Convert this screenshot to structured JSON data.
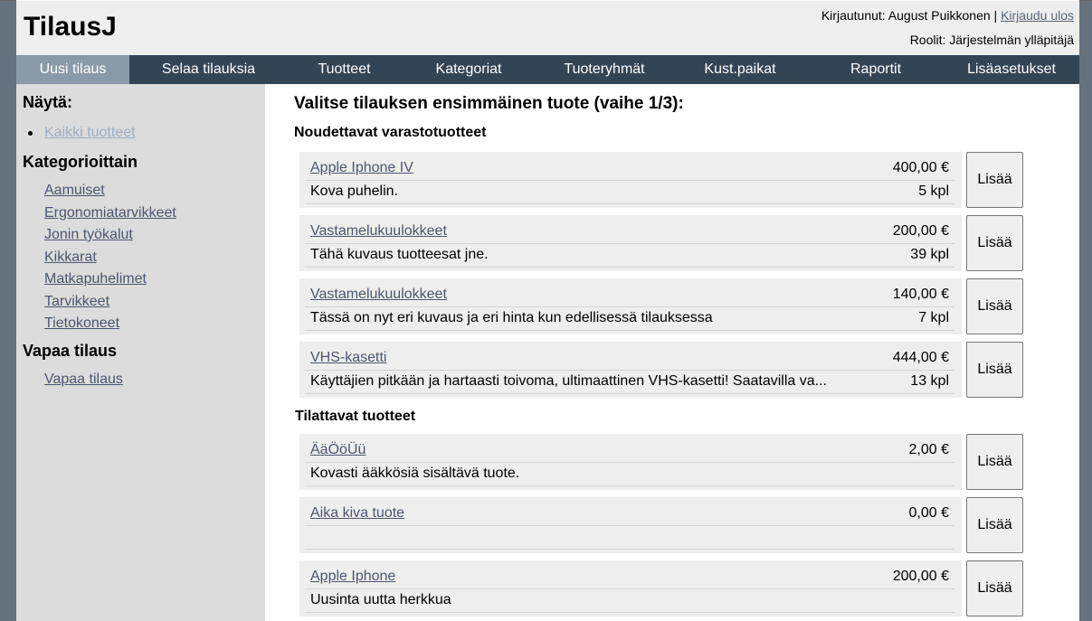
{
  "app": {
    "title": "TilausJ"
  },
  "user": {
    "logged_in_label": "Kirjautunut: August Puikkonen | ",
    "logout_label": "Kirjaudu ulos",
    "roles_label": "Roolit: Järjestelmän ylläpitäjä"
  },
  "nav": {
    "items": [
      {
        "label": "Uusi tilaus",
        "active": true
      },
      {
        "label": "Selaa tilauksia"
      },
      {
        "label": "Tuotteet"
      },
      {
        "label": "Kategoriat"
      },
      {
        "label": "Tuoteryhmät"
      },
      {
        "label": "Kust.paikat"
      },
      {
        "label": "Raportit"
      },
      {
        "label": "Lisäasetukset"
      }
    ]
  },
  "sidebar": {
    "show_heading": "Näytä:",
    "all_products": "Kaikki tuotteet",
    "categories_heading": "Kategorioittain",
    "categories": [
      "Aamuiset",
      "Ergonomiatarvikkeet",
      "Jonin työkalut",
      "Kikkarat",
      "Matkapuhelimet",
      "Tarvikkeet",
      "Tietokoneet"
    ],
    "free_order_heading": "Vapaa tilaus",
    "free_order_link": "Vapaa tilaus"
  },
  "main": {
    "title": "Valitse tilauksen ensimmäinen tuote (vaihe 1/3):",
    "add_label": "Lisää",
    "sections": [
      {
        "heading": "Noudettavat varastotuotteet",
        "products": [
          {
            "name": "Apple Iphone IV",
            "price": "400,00 €",
            "desc": "Kova puhelin.",
            "qty": "5 kpl"
          },
          {
            "name": "Vastamelukuulokkeet",
            "price": "200,00 €",
            "desc": "Tähä kuvaus tuotteesat jne.",
            "qty": "39 kpl"
          },
          {
            "name": "Vastamelukuulokkeet",
            "price": "140,00 €",
            "desc": "Tässä on nyt eri kuvaus ja eri hinta kun edellisessä tilauksessa",
            "qty": "7 kpl"
          },
          {
            "name": "VHS-kasetti",
            "price": "444,00 €",
            "desc": "Käyttäjien pitkään ja hartaasti toivoma, ultimaattinen VHS-kasetti! Saatavilla va...",
            "qty": "13 kpl"
          }
        ]
      },
      {
        "heading": "Tilattavat tuotteet",
        "products": [
          {
            "name": "ÄäÖöÜü",
            "price": "2,00 €",
            "desc": "Kovasti ääkkösiä sisältävä tuote.",
            "qty": ""
          },
          {
            "name": "Aika kiva tuote",
            "price": "0,00 €",
            "desc": "",
            "qty": ""
          },
          {
            "name": "Apple Iphone",
            "price": "200,00 €",
            "desc": "Uusinta uutta herkkua",
            "qty": ""
          }
        ]
      }
    ]
  }
}
